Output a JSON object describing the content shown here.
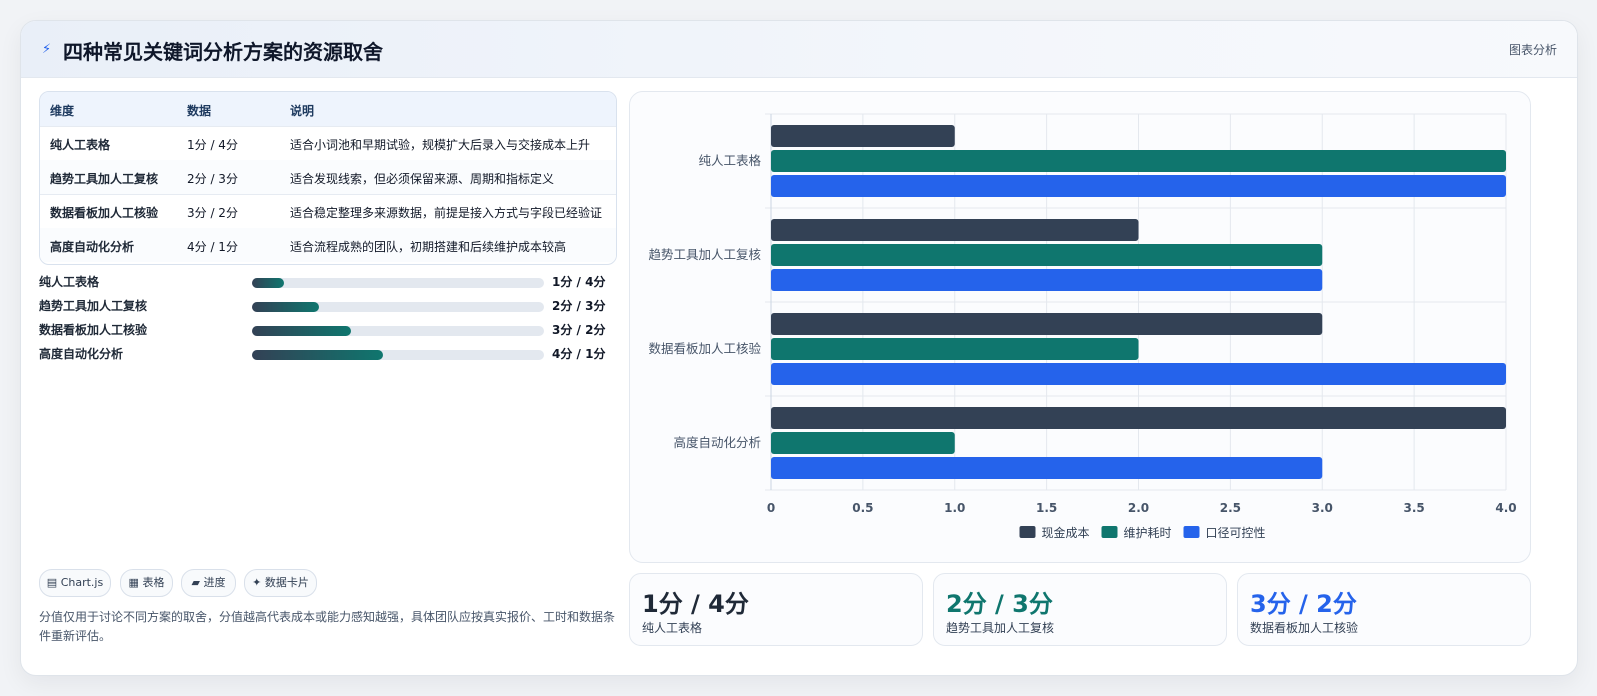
{
  "header": {
    "icon": "bolt-icon",
    "title": "四种常见关键词分析方案的资源取舍",
    "tag": "图表分析"
  },
  "table": {
    "columns": [
      "维度",
      "数据",
      "说明"
    ],
    "rows": [
      [
        "纯人工表格",
        "1分 / 4分",
        "适合小词池和早期试验，规模扩大后录入与交接成本上升"
      ],
      [
        "趋势工具加人工复核",
        "2分 / 3分",
        "适合发现线索，但必须保留来源、周期和指标定义"
      ],
      [
        "数据看板加人工核验",
        "3分 / 2分",
        "适合稳定整理多来源数据，前提是接入方式与字段已经验证"
      ],
      [
        "高度自动化分析",
        "4分 / 1分",
        "适合流程成熟的团队，初期搭建和后续维护成本较高"
      ]
    ]
  },
  "progress": [
    {
      "label": "纯人工表格",
      "value": "1分 / 4分",
      "level": 0.11
    },
    {
      "label": "趋势工具加人工复核",
      "value": "2分 / 3分",
      "level": 0.23
    },
    {
      "label": "数据看板加人工核验",
      "value": "3分 / 2分",
      "level": 0.34
    },
    {
      "label": "高度自动化分析",
      "value": "4分 / 1分",
      "level": 0.45
    }
  ],
  "chips": [
    {
      "icon": "chart-icon",
      "label": "Chart.js"
    },
    {
      "icon": "table-icon",
      "label": "表格"
    },
    {
      "icon": "progress-icon",
      "label": "进度"
    },
    {
      "icon": "sparkle-icon",
      "label": "数据卡片"
    }
  ],
  "note": "分值仅用于讨论不同方案的取舍，分值越高代表成本或能力感知越强，具体团队应按真实报价、工时和数据条件重新评估。",
  "kpis": [
    {
      "value": "1分 / 4分",
      "label": "纯人工表格",
      "color": "#1f2937"
    },
    {
      "value": "2分 / 3分",
      "label": "趋势工具加人工复核",
      "color": "#0f766e"
    },
    {
      "value": "3分 / 2分",
      "label": "数据看板加人工核验",
      "color": "#2563eb"
    }
  ],
  "chart_data": {
    "type": "bar",
    "orientation": "horizontal",
    "categories": [
      "纯人工表格",
      "趋势工具加人工复核",
      "数据看板加人工核验",
      "高度自动化分析"
    ],
    "series": [
      {
        "name": "现金成本",
        "color": "#334155",
        "values": [
          1,
          2,
          3,
          4
        ]
      },
      {
        "name": "维护耗时",
        "color": "#0f766e",
        "values": [
          4,
          3,
          2,
          1
        ]
      },
      {
        "name": "口径可控性",
        "color": "#2563eb",
        "values": [
          4,
          3,
          4,
          3
        ]
      }
    ],
    "xlim": [
      0,
      4
    ],
    "xticks": [
      "0",
      "0.5",
      "1.0",
      "1.5",
      "2.0",
      "2.5",
      "3.0",
      "3.5",
      "4.0"
    ],
    "grid": true,
    "legend": "bottom"
  }
}
